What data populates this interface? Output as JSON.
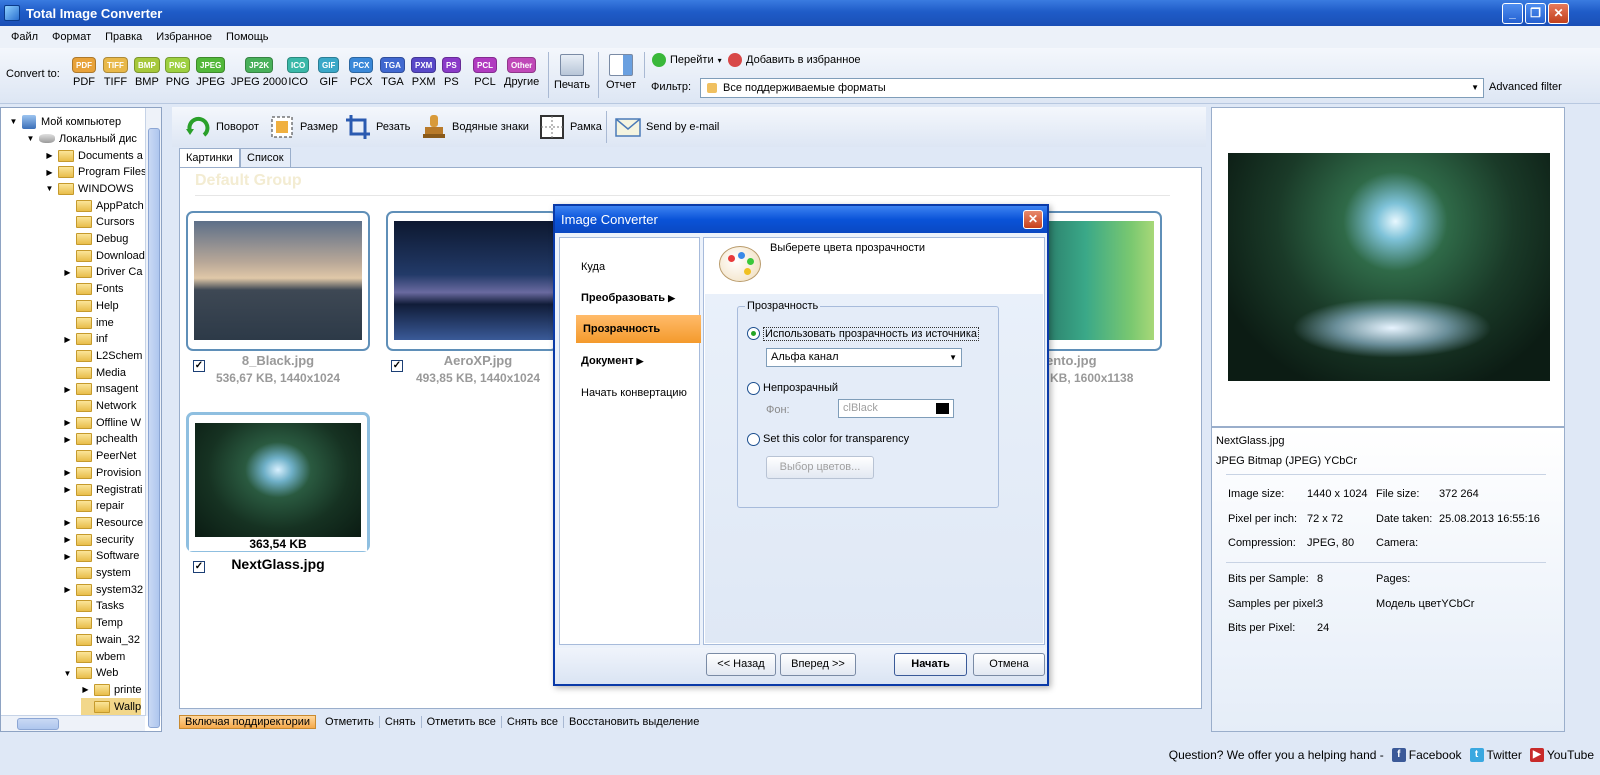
{
  "window": {
    "title": "Total Image Converter"
  },
  "menu": [
    "Файл",
    "Формат",
    "Правка",
    "Избранное",
    "Помощь"
  ],
  "toolbar": {
    "convert_to": "Convert to:",
    "formats": [
      {
        "badge": "PDF",
        "label": "PDF",
        "color": "#e8a23a"
      },
      {
        "badge": "TIFF",
        "label": "TIFF",
        "color": "#e8b84a"
      },
      {
        "badge": "BMP",
        "label": "BMP",
        "color": "#a6c83a"
      },
      {
        "badge": "PNG",
        "label": "PNG",
        "color": "#9dd040"
      },
      {
        "badge": "JPEG",
        "label": "JPEG",
        "color": "#52b83a"
      },
      {
        "badge": "JP2K",
        "label": "JPEG 2000",
        "color": "#48b05a"
      },
      {
        "badge": "ICO",
        "label": "ICO",
        "color": "#3ab8a8"
      },
      {
        "badge": "GIF",
        "label": "GIF",
        "color": "#3aa8c8"
      },
      {
        "badge": "PCX",
        "label": "PCX",
        "color": "#3a88d8"
      },
      {
        "badge": "TGA",
        "label": "TGA",
        "color": "#4068d0"
      },
      {
        "badge": "PXM",
        "label": "PXM",
        "color": "#5848c8"
      },
      {
        "badge": "PS",
        "label": "PS",
        "color": "#8a3ac8"
      },
      {
        "badge": "PCL",
        "label": "PCL",
        "color": "#b03ac0"
      },
      {
        "badge": "Other",
        "label": "Другие",
        "color": "#c048b8"
      }
    ],
    "print": "Печать",
    "report": "Отчет",
    "goto": "Перейти",
    "add_fav": "Добавить в избранное",
    "filter_label": "Фильтр:",
    "filter_value": "Все поддерживаемые форматы",
    "advanced_filter": "Advanced filter"
  },
  "tree": {
    "root": "Мой компьютер",
    "disk": "Локальный дис",
    "items": [
      {
        "label": "Documents a",
        "level": 2,
        "expander": "▶"
      },
      {
        "label": "Program Files",
        "level": 2,
        "expander": "▶"
      },
      {
        "label": "WINDOWS",
        "level": 2,
        "expander": "▼"
      },
      {
        "label": "AppPatch",
        "level": 3,
        "expander": ""
      },
      {
        "label": "Cursors",
        "level": 3,
        "expander": ""
      },
      {
        "label": "Debug",
        "level": 3,
        "expander": ""
      },
      {
        "label": "Download",
        "level": 3,
        "expander": ""
      },
      {
        "label": "Driver Ca",
        "level": 3,
        "expander": "▶"
      },
      {
        "label": "Fonts",
        "level": 3,
        "expander": ""
      },
      {
        "label": "Help",
        "level": 3,
        "expander": ""
      },
      {
        "label": "ime",
        "level": 3,
        "expander": ""
      },
      {
        "label": "inf",
        "level": 3,
        "expander": "▶"
      },
      {
        "label": "L2Schem",
        "level": 3,
        "expander": ""
      },
      {
        "label": "Media",
        "level": 3,
        "expander": ""
      },
      {
        "label": "msagent",
        "level": 3,
        "expander": "▶"
      },
      {
        "label": "Network",
        "level": 3,
        "expander": ""
      },
      {
        "label": "Offline W",
        "level": 3,
        "expander": "▶"
      },
      {
        "label": "pchealth",
        "level": 3,
        "expander": "▶"
      },
      {
        "label": "PeerNet",
        "level": 3,
        "expander": ""
      },
      {
        "label": "Provision",
        "level": 3,
        "expander": "▶"
      },
      {
        "label": "Registrati",
        "level": 3,
        "expander": "▶"
      },
      {
        "label": "repair",
        "level": 3,
        "expander": ""
      },
      {
        "label": "Resource",
        "level": 3,
        "expander": "▶"
      },
      {
        "label": "security",
        "level": 3,
        "expander": "▶"
      },
      {
        "label": "Software",
        "level": 3,
        "expander": "▶"
      },
      {
        "label": "system",
        "level": 3,
        "expander": ""
      },
      {
        "label": "system32",
        "level": 3,
        "expander": "▶"
      },
      {
        "label": "Tasks",
        "level": 3,
        "expander": ""
      },
      {
        "label": "Temp",
        "level": 3,
        "expander": ""
      },
      {
        "label": "twain_32",
        "level": 3,
        "expander": ""
      },
      {
        "label": "wbem",
        "level": 3,
        "expander": ""
      },
      {
        "label": "Web",
        "level": 3,
        "expander": "▼"
      },
      {
        "label": "printe",
        "level": 4,
        "expander": "▶"
      },
      {
        "label": "Wallp",
        "level": 4,
        "expander": ""
      }
    ]
  },
  "edit_toolbar": {
    "rotate": "Поворот",
    "resize": "Размер",
    "crop": "Резать",
    "watermark": "Водяные знаки",
    "frame": "Рамка",
    "email": "Send by e-mail"
  },
  "tabs": [
    "Картинки",
    "Список"
  ],
  "group_header": "Default Group",
  "thumbs": [
    {
      "name": "8_Black.jpg",
      "info": "536,67 KB, 1440x1024"
    },
    {
      "name": "AeroXP.jpg",
      "info": "493,85 KB, 1440x1024"
    },
    {
      "name": "ento.jpg",
      "info": "KB, 1600x1138"
    },
    {
      "name": "NextGlass.jpg",
      "size_overlay": "363,54 KB"
    }
  ],
  "bottom_bar": [
    "Включая поддиректории",
    "Отметить",
    "Снять",
    "Отметить все",
    "Снять все",
    "Восстановить выделение"
  ],
  "preview_info": {
    "filename": "NextGlass.jpg",
    "format": "JPEG Bitmap (JPEG) YCbCr",
    "image_size_label": "Image size:",
    "image_size": "1440 x 1024",
    "file_size_label": "File size:",
    "file_size": "372 264",
    "ppi_label": "Pixel per inch:",
    "ppi": "72 x 72",
    "date_label": "Date taken:",
    "date": "25.08.2013 16:55:16",
    "compression_label": "Compression:",
    "compression": "JPEG, 80",
    "camera_label": "Camera:",
    "bps_label": "Bits per Sample:",
    "bps": "8",
    "pages_label": "Pages:",
    "spp_label": "Samples per pixel:",
    "spp": "3",
    "color_model": "Модель цветYCbCr",
    "bpp_label": "Bits per Pixel:",
    "bpp": "24"
  },
  "status": {
    "question": "Question? We offer you a helping hand -",
    "facebook": "Facebook",
    "twitter": "Twitter",
    "youtube": "YouTube"
  },
  "dialog": {
    "title": "Image Converter",
    "nav": [
      "Куда",
      "Преобразовать",
      "Прозрачность",
      "Документ",
      "Начать конвертацию"
    ],
    "heading": "Выберете цвета прозрачности",
    "group_label": "Прозрачность",
    "opt_source": "Использовать прозрачность из источника",
    "alpha_combo": "Альфа канал",
    "opt_opaque": "Непрозрачный",
    "bg_label": "Фон:",
    "bg_color": "clBlack",
    "opt_color": "Set this color for transparency",
    "pick_colors": "Выбор цветов...",
    "back": "<< Назад",
    "next": "Вперед >>",
    "start": "Начать",
    "cancel": "Отмена"
  }
}
